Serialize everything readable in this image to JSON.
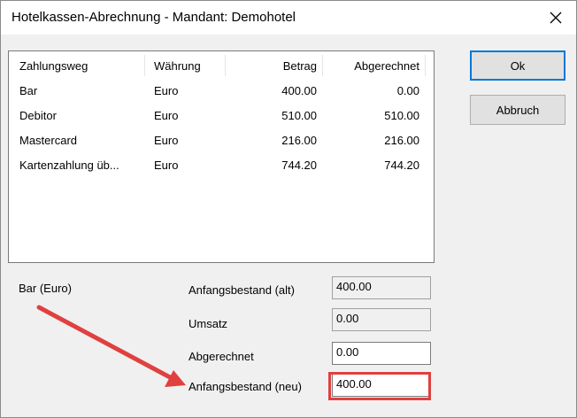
{
  "window": {
    "title": "Hotelkassen-Abrechnung - Mandant: Demohotel"
  },
  "list": {
    "headers": [
      "Zahlungsweg",
      "Währung",
      "Betrag",
      "Abgerechnet"
    ],
    "rows": [
      [
        "Bar",
        "Euro",
        "400.00",
        "0.00"
      ],
      [
        "Debitor",
        "Euro",
        "510.00",
        "510.00"
      ],
      [
        "Mastercard",
        "Euro",
        "216.00",
        "216.00"
      ],
      [
        "Kartenzahlung üb...",
        "Euro",
        "744.20",
        "744.20"
      ]
    ]
  },
  "buttons": {
    "ok": "Ok",
    "cancel": "Abbruch"
  },
  "details": {
    "selection": "Bar (Euro)",
    "anfangsbestand_alt_label": "Anfangsbestand (alt)",
    "anfangsbestand_alt_value": "400.00",
    "umsatz_label": "Umsatz",
    "umsatz_value": "0.00",
    "abgerechnet_label": "Abgerechnet",
    "abgerechnet_value": "0.00",
    "anfangsbestand_neu_label": "Anfangsbestand (neu)",
    "anfangsbestand_neu_value": "400.00"
  },
  "annotation": {
    "arrow_color": "#e04040",
    "highlight_color": "#e04040"
  }
}
